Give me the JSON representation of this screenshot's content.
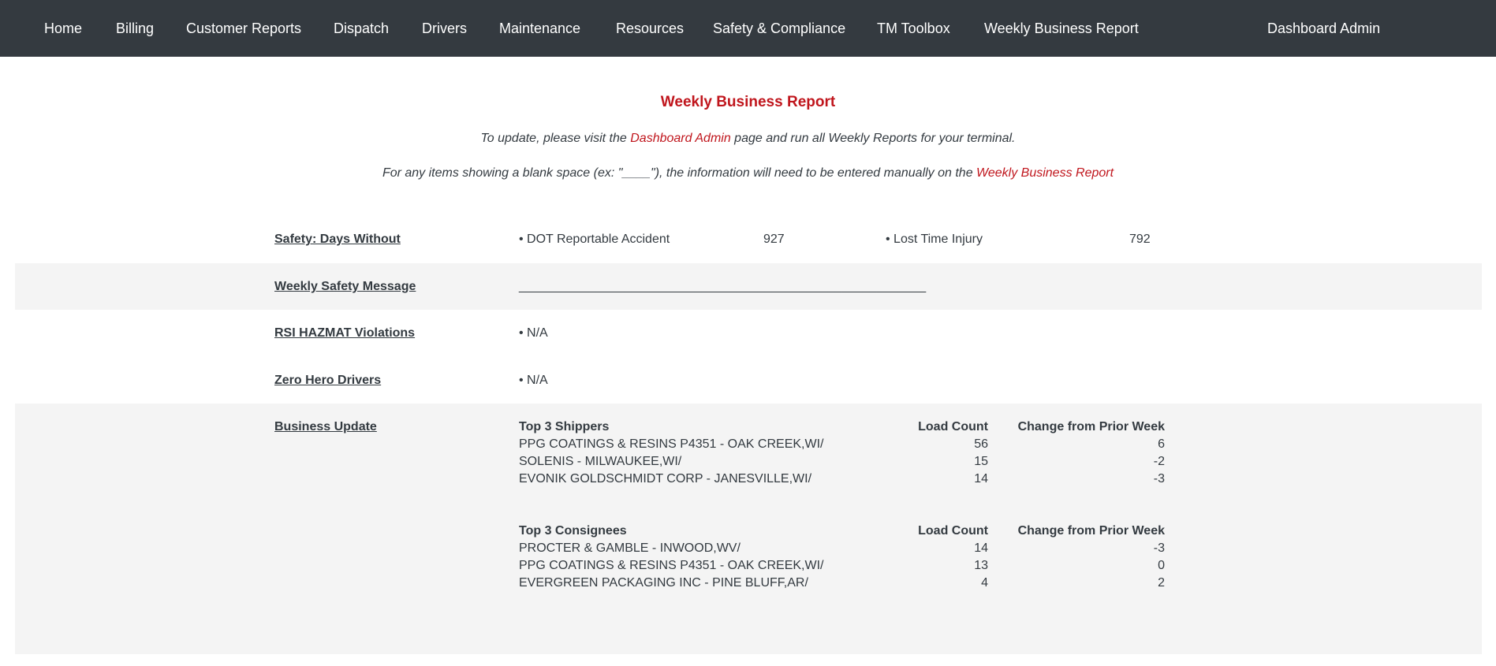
{
  "nav": {
    "items": [
      {
        "label": "Home"
      },
      {
        "label": "Billing"
      },
      {
        "label": "Customer Reports"
      },
      {
        "label": "Dispatch"
      },
      {
        "label": "Drivers"
      },
      {
        "label": "Maintenance"
      },
      {
        "label": "Resources"
      },
      {
        "label": "Safety & Compliance"
      },
      {
        "label": "TM Toolbox"
      },
      {
        "label": "Weekly Business Report"
      }
    ],
    "right_item": "Dashboard Admin"
  },
  "header": {
    "title": "Weekly Business Report",
    "note1_pre": "To update, please visit the ",
    "note1_link": "Dashboard Admin",
    "note1_post": " page and run all Weekly Reports for your terminal.",
    "note2_pre": "For any items showing a blank space (ex: \"____\"), the information will need to be entered manually on the ",
    "note2_link": "Weekly Business Report"
  },
  "safety": {
    "label": "Safety: Days Without",
    "item1_label": "• DOT Reportable Accident",
    "item1_value": "927",
    "item2_label": "• Lost Time Injury",
    "item2_value": "792"
  },
  "safety_message": {
    "label": "Weekly Safety Message",
    "value": "__________________________________________________________"
  },
  "hazmat": {
    "label": "RSI HAZMAT Violations",
    "value": "• N/A"
  },
  "zero_hero": {
    "label": "Zero Hero Drivers",
    "value": "• N/A"
  },
  "business": {
    "label": "Business Update",
    "shippers": {
      "heading": "Top 3 Shippers",
      "count_header": "Load Count",
      "change_header": "Change from Prior Week",
      "rows": [
        {
          "name": "PPG COATINGS & RESINS P4351 - OAK CREEK,WI/",
          "count": "56",
          "change": "6"
        },
        {
          "name": "SOLENIS - MILWAUKEE,WI/",
          "count": "15",
          "change": "-2"
        },
        {
          "name": "EVONIK GOLDSCHMIDT CORP - JANESVILLE,WI/",
          "count": "14",
          "change": "-3"
        }
      ]
    },
    "consignees": {
      "heading": "Top 3 Consignees",
      "count_header": "Load Count",
      "change_header": "Change from Prior Week",
      "rows": [
        {
          "name": "PROCTER & GAMBLE - INWOOD,WV/",
          "count": "14",
          "change": "-3"
        },
        {
          "name": "PPG COATINGS & RESINS P4351 - OAK CREEK,WI/",
          "count": "13",
          "change": "0"
        },
        {
          "name": "EVERGREEN PACKAGING INC - PINE BLUFF,AR/",
          "count": "4",
          "change": "2"
        }
      ]
    }
  }
}
